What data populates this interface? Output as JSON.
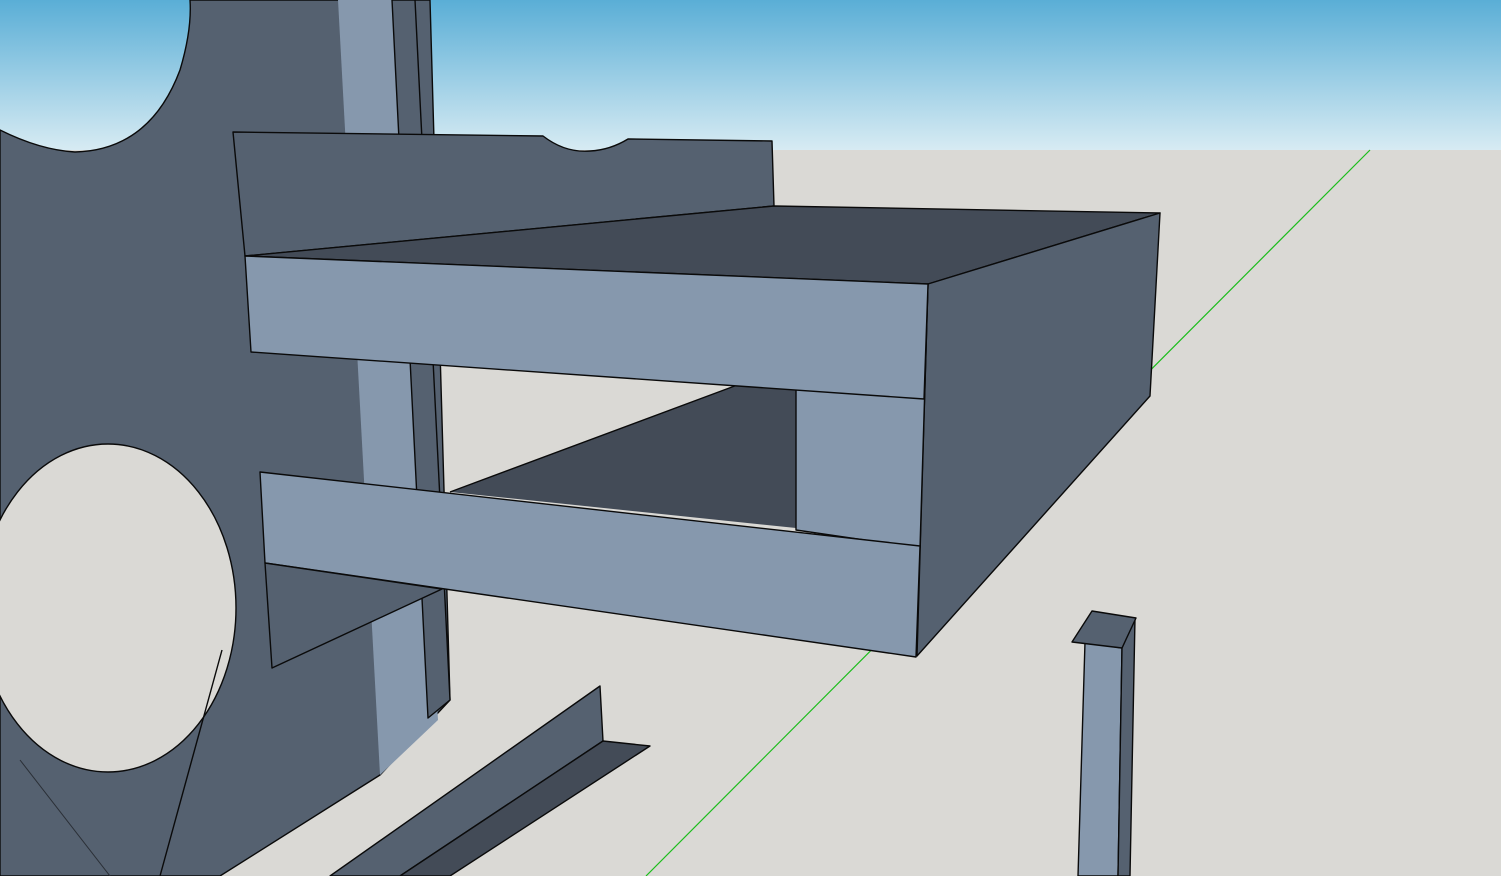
{
  "app": {
    "view": "3d-model-viewport"
  },
  "colors": {
    "sky_top": "#5aaed6",
    "sky_bottom": "#d7ebf3",
    "ground": "#dad9d5",
    "face_dark": "#556170",
    "face_darker": "#434b57",
    "face_light": "#8698ad",
    "edge": "#0a0a0a",
    "green_axis": "#1bbd1b"
  },
  "scene": {
    "objects": [
      "vertical-plate-with-holes",
      "vertical-post",
      "box-bracket",
      "angle-bracket",
      "small-post"
    ],
    "axes": [
      "green-axis"
    ]
  }
}
